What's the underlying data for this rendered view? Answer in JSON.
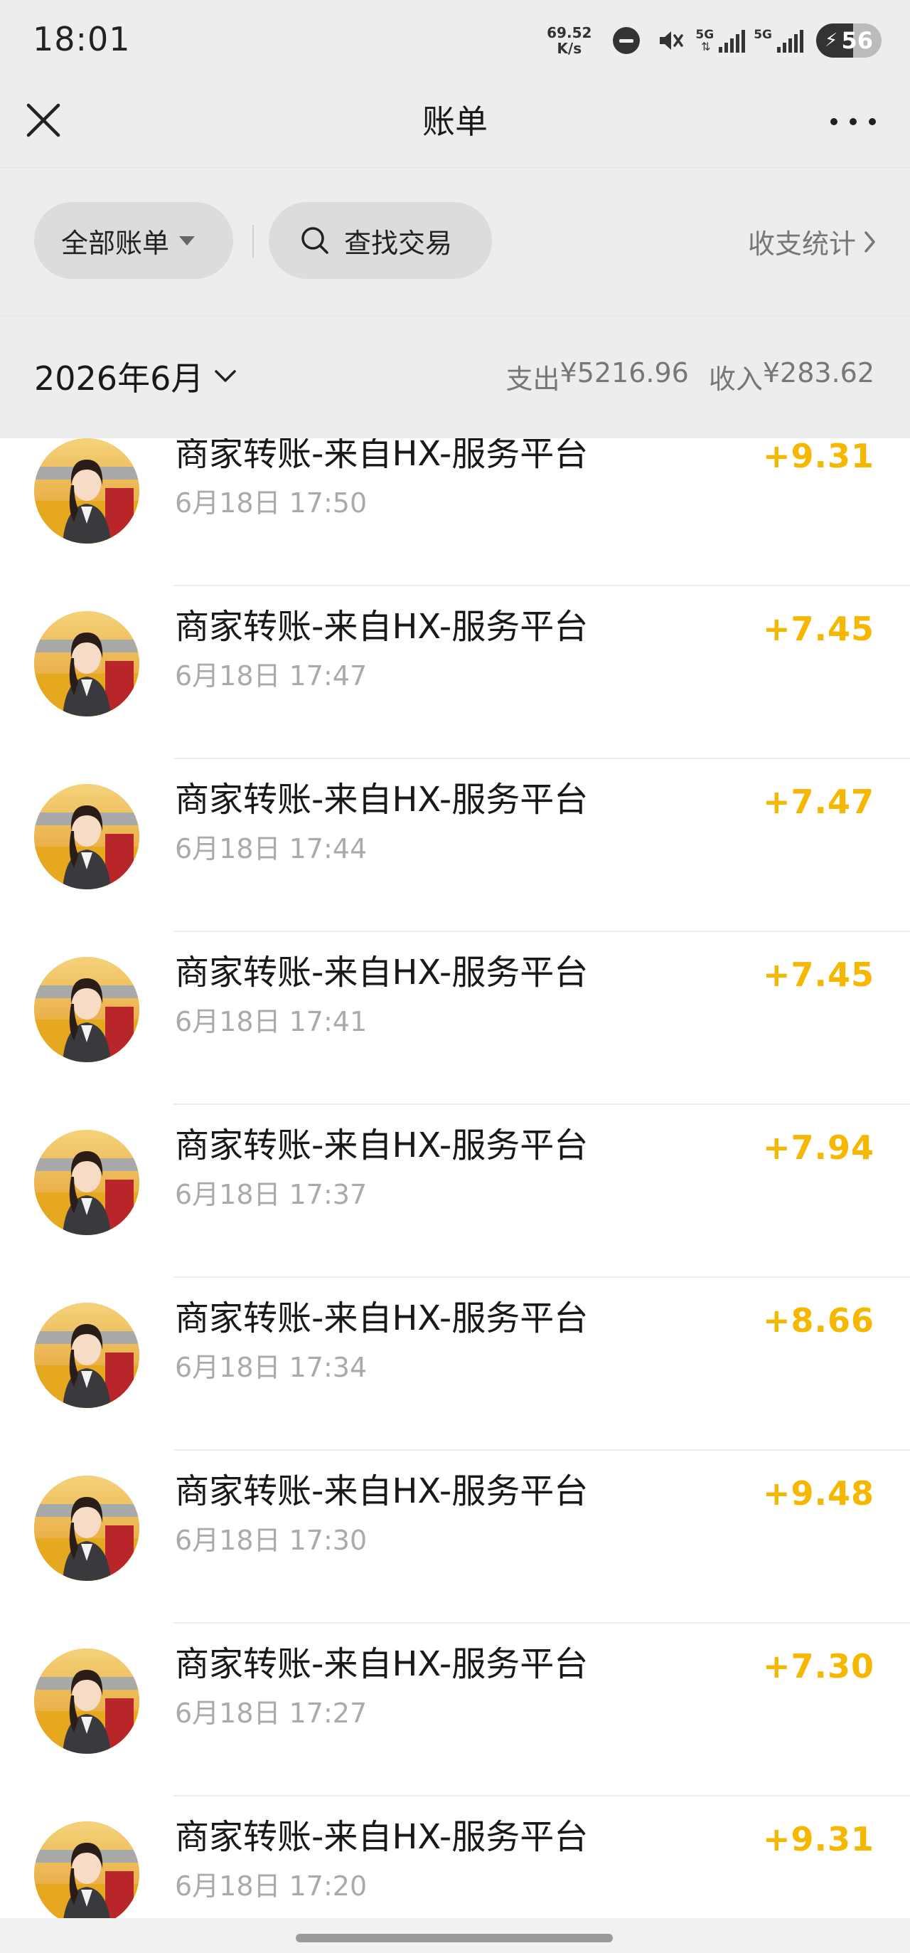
{
  "status_bar": {
    "time": "18:01",
    "net_speed_value": "69.52",
    "net_speed_unit": "K/s",
    "sim1_label": "5G",
    "sim2_label": "5G",
    "battery_level": "56",
    "icons": [
      "do-not-disturb-icon",
      "mute-icon",
      "signal-icon",
      "signal-icon",
      "charging-icon"
    ]
  },
  "nav": {
    "title": "账单"
  },
  "filter_bar": {
    "all_bills_label": "全部账单",
    "search_label": "查找交易",
    "stats_label": "收支统计"
  },
  "month": {
    "label": "2026年6月",
    "expense_label": "支出",
    "expense_value": "¥5216.96",
    "income_label": "收入",
    "income_value": "¥283.62"
  },
  "transactions": [
    {
      "title": "商家转账-来自HX-服务平台",
      "time": "6月18日 17:50",
      "amount": "+9.31"
    },
    {
      "title": "商家转账-来自HX-服务平台",
      "time": "6月18日 17:47",
      "amount": "+7.45"
    },
    {
      "title": "商家转账-来自HX-服务平台",
      "time": "6月18日 17:44",
      "amount": "+7.47"
    },
    {
      "title": "商家转账-来自HX-服务平台",
      "time": "6月18日 17:41",
      "amount": "+7.45"
    },
    {
      "title": "商家转账-来自HX-服务平台",
      "time": "6月18日 17:37",
      "amount": "+7.94"
    },
    {
      "title": "商家转账-来自HX-服务平台",
      "time": "6月18日 17:34",
      "amount": "+8.66"
    },
    {
      "title": "商家转账-来自HX-服务平台",
      "time": "6月18日 17:30",
      "amount": "+9.48"
    },
    {
      "title": "商家转账-来自HX-服务平台",
      "time": "6月18日 17:27",
      "amount": "+7.30"
    },
    {
      "title": "商家转账-来自HX-服务平台",
      "time": "6月18日 17:20",
      "amount": "+9.31"
    }
  ],
  "colors": {
    "income_amount": "#f5b700",
    "header_bg": "#ededed"
  }
}
